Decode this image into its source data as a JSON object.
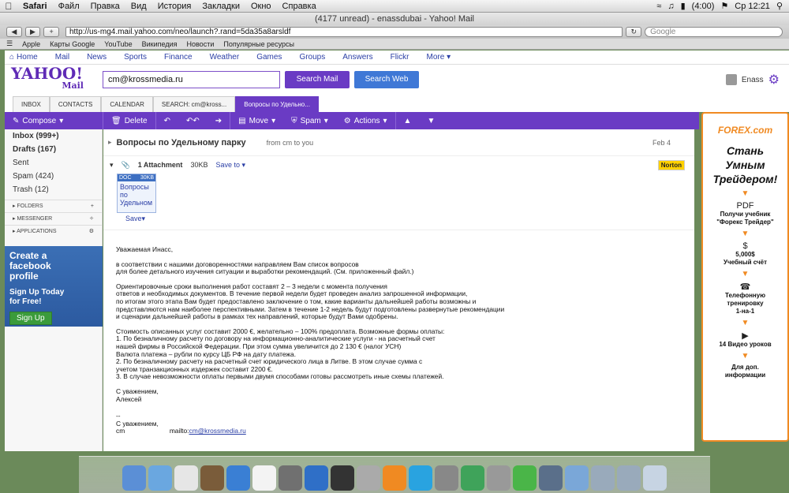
{
  "menubar": {
    "app": "Safari",
    "items": [
      "Файл",
      "Правка",
      "Вид",
      "История",
      "Закладки",
      "Окно",
      "Справка"
    ],
    "battery": "(4:00)",
    "clock": "Ср 12:21"
  },
  "window": {
    "title": "(4177 unread) - enassdubai - Yahoo! Mail"
  },
  "toolbar": {
    "url": "http://us-mg4.mail.yahoo.com/neo/launch?.rand=5da35a8arsldf",
    "search_placeholder": "Google"
  },
  "bookmarks": [
    "Apple",
    "Карты Google",
    "YouTube",
    "Википедия",
    "Новости",
    "Популярные ресурсы"
  ],
  "ynav": [
    "Home",
    "Mail",
    "News",
    "Sports",
    "Finance",
    "Weather",
    "Games",
    "Groups",
    "Answers",
    "Flickr",
    "More"
  ],
  "header": {
    "logo": "YAHOO!",
    "logo_sub": "Mail",
    "search_value": "cm@krossmedia.ru",
    "search_mail": "Search Mail",
    "search_web": "Search Web",
    "user": "Enass"
  },
  "tabs": [
    "INBOX",
    "CONTACTS",
    "CALENDAR",
    "SEARCH: cm@kross...",
    "Вопросы по Удельно..."
  ],
  "actions": {
    "compose": "Compose",
    "delete": "Delete",
    "move": "Move",
    "spam": "Spam",
    "actions": "Actions"
  },
  "sidebar": {
    "folders": [
      {
        "label": "Inbox (999+)",
        "bold": true
      },
      {
        "label": "Drafts (167)",
        "bold": true
      },
      {
        "label": "Sent",
        "bold": false
      },
      {
        "label": "Spam (424)",
        "bold": false
      },
      {
        "label": "Trash (12)",
        "bold": false
      }
    ],
    "sections": [
      "FOLDERS",
      "MESSENGER",
      "APPLICATIONS"
    ],
    "fbad": {
      "line1": "Create a",
      "line2": "facebook",
      "line3": "profile",
      "line4": "Sign Up Today",
      "line5": "for Free!",
      "button": "Sign Up"
    }
  },
  "message": {
    "subject": "Вопросы по Удельному парку",
    "from": "from cm to you",
    "date": "Feb 4",
    "attach_label": "1 Attachment",
    "attach_size": "30KB",
    "save_to": "Save to",
    "norton": "Norton",
    "card_type": "DOC",
    "card_size": "30KB",
    "card_name": "Вопросы по Удельном",
    "card_save": "Save",
    "body": {
      "greeting": "Уважаемая Инасс,",
      "p1": [
        "в соответствии с нашими договоренностями направляем Вам список вопросов",
        "для более детального изучения ситуации и выработки рекомендаций. (См. приложенный файл.)"
      ],
      "p2": [
        "Ориентировочные сроки выполнения работ составят 2 – 3 недели с момента получения",
        "ответов и необходимых документов. В течение первой недели будет проведен анализ запрошенной информации,",
        "по итогам этого этапа Вам будет предоставлено заключение о том, какие варианты дальнейшей работы возможны и",
        "представляются нам наиболее перспективными. Затем в течение 1-2 недель будут подготовлены развернутые рекомендации",
        "и сценарии дальнейшей работы в рамках тех направлений, которые будут Вами одобрены."
      ],
      "p3": [
        "Стоимость описанных услуг составит 2000 €, желательно – 100% предоплата. Возможные формы оплаты:",
        "1. По безналичному расчету по договору на информационно-аналитические услуги - на расчетный счет",
        "нашей фирмы в Российской Федерации. При этом сумма увеличится до 2 130 € (налог УСН)",
        "Валюта платежа – рубли по курсу ЦБ РФ на дату платежа.",
        "2. По безналичному расчету на расчетный счет юридического лица в Литве. В этом случае сумма с",
        "учетом транзакционных издержек составит 2200 €.",
        "3. В случае невозможности оплаты первыми двумя способами готовы рассмотреть иные схемы платежей."
      ],
      "closing1": "С уважением,",
      "closing2": "Алексей",
      "sig_dash": "--",
      "closing3": "С уважением,",
      "sig_name": "cm",
      "sig_mailto": "mailto:",
      "sig_email": "cm@krossmedia.ru"
    }
  },
  "ad": {
    "brand": "FOREX.com",
    "headline": [
      "Стань",
      "Умным",
      "Трейдером!"
    ],
    "items": [
      {
        "icon": "PDF",
        "text": [
          "Получи учебник",
          "\"Форекс Трейдер\""
        ]
      },
      {
        "icon": "$",
        "text": [
          "5,000$",
          "Учебный счёт"
        ]
      },
      {
        "icon": "☎",
        "text": [
          "Телефонную",
          "тренировку",
          "1-на-1"
        ]
      },
      {
        "icon": "▶",
        "text": [
          "14 Видео уроков"
        ]
      },
      {
        "icon": "",
        "text": [
          "Для доп.",
          "информации"
        ]
      }
    ]
  },
  "dock": {
    "colors": [
      "#5b8fd6",
      "#6aa7e0",
      "#e6e6e6",
      "#7a5c3a",
      "#3a7fd4",
      "#f3f3f3",
      "#707070",
      "#2f6fc7",
      "#333",
      "#aaa",
      "#f08a22",
      "#29a3e0",
      "#888",
      "#3fa35a",
      "#999",
      "#4ab548",
      "#5a6f8a",
      "#7aa7d8",
      "#9ab",
      "#9ab",
      "#c7d4e3"
    ]
  }
}
